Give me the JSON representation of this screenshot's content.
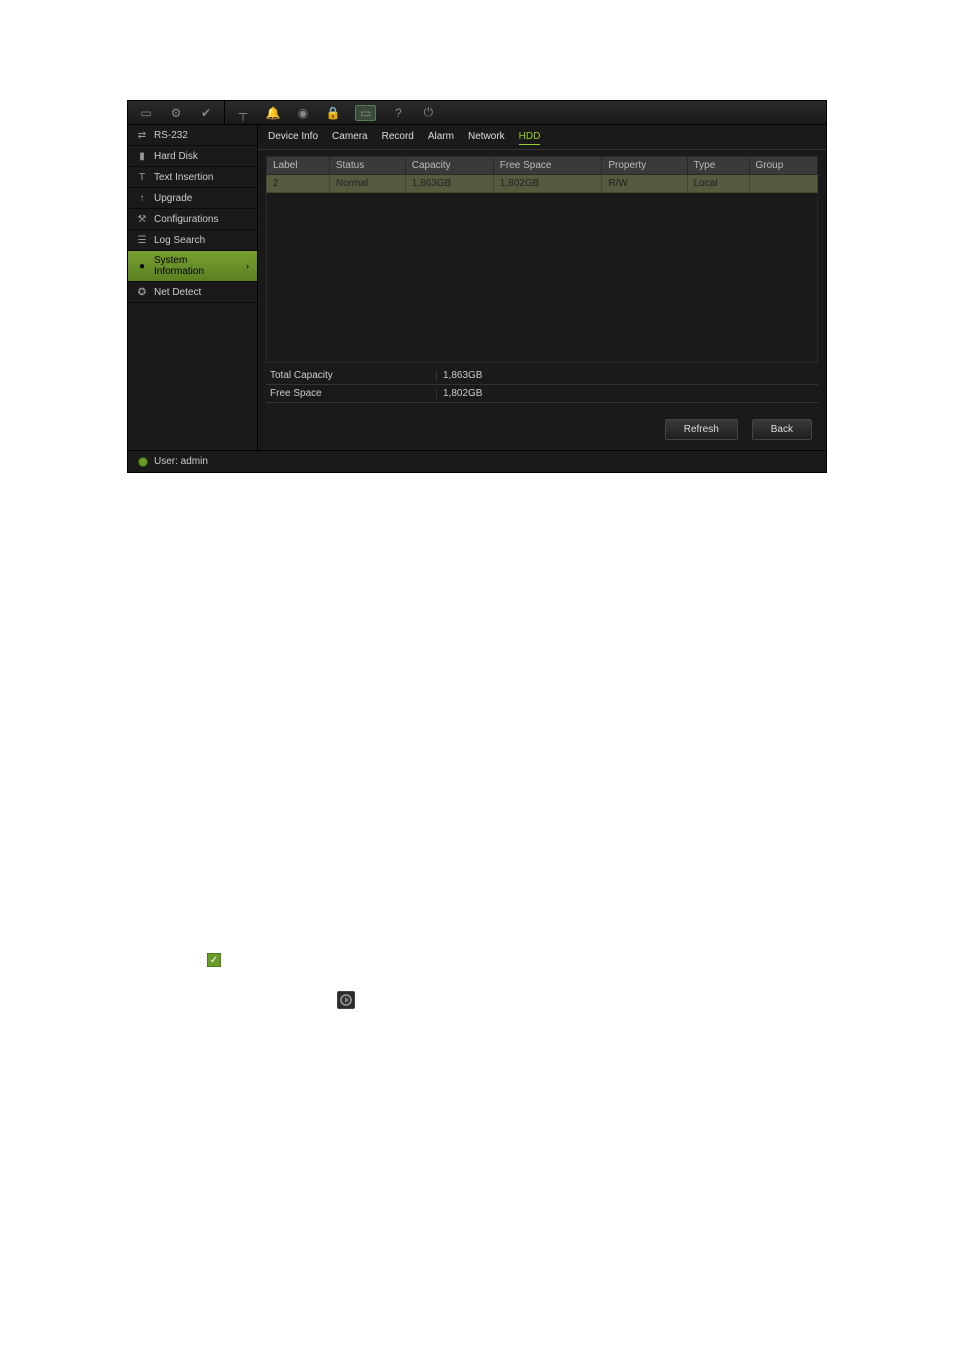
{
  "toolbar": {
    "icons": [
      {
        "name": "monitor-icon",
        "glyph": "▭"
      },
      {
        "name": "camera-icon",
        "glyph": "⚙"
      },
      {
        "name": "check-circle-icon",
        "glyph": "✔"
      },
      {
        "name": "network-icon",
        "glyph": "┬"
      },
      {
        "name": "bell-icon",
        "glyph": "🔔"
      },
      {
        "name": "globe-icon",
        "glyph": "◉"
      },
      {
        "name": "lock-icon",
        "glyph": "🔒"
      },
      {
        "name": "display-config-icon",
        "glyph": "▭",
        "active": true
      },
      {
        "name": "help-icon",
        "glyph": "?"
      },
      {
        "name": "power-icon",
        "glyph": "⏻"
      }
    ]
  },
  "sidebar": {
    "items": [
      {
        "icon": "serial-icon",
        "glyph": "⇄",
        "label": "RS-232"
      },
      {
        "icon": "hdd-icon",
        "glyph": "▮",
        "label": "Hard Disk"
      },
      {
        "icon": "text-insert-icon",
        "glyph": "T",
        "label": "Text Insertion"
      },
      {
        "icon": "upgrade-icon",
        "glyph": "↑",
        "label": "Upgrade"
      },
      {
        "icon": "config-icon",
        "glyph": "⚒",
        "label": "Configurations"
      },
      {
        "icon": "log-icon",
        "glyph": "☰",
        "label": "Log Search"
      },
      {
        "icon": "info-icon",
        "glyph": "●",
        "label": "System Information",
        "selected": true
      },
      {
        "icon": "net-detect-icon",
        "glyph": "✪",
        "label": "Net Detect"
      }
    ]
  },
  "tabs": [
    {
      "label": "Device Info"
    },
    {
      "label": "Camera"
    },
    {
      "label": "Record"
    },
    {
      "label": "Alarm"
    },
    {
      "label": "Network"
    },
    {
      "label": "HDD",
      "active": true
    }
  ],
  "table": {
    "headers": [
      "Label",
      "Status",
      "Capacity",
      "Free Space",
      "Property",
      "Type",
      "Group"
    ],
    "rows": [
      {
        "Label": "2",
        "Status": "Normal",
        "Capacity": "1,863GB",
        "Free Space": "1,802GB",
        "Property": "R/W",
        "Type": "Local",
        "Group": ""
      }
    ]
  },
  "summary": {
    "total_label": "Total Capacity",
    "total_value": "1,863GB",
    "free_label": "Free Space",
    "free_value": "1,802GB"
  },
  "buttons": {
    "refresh": "Refresh",
    "back": "Back"
  },
  "statusbar": {
    "user_label": "User: admin"
  },
  "badges": {
    "check": "✓",
    "play": "▶"
  }
}
